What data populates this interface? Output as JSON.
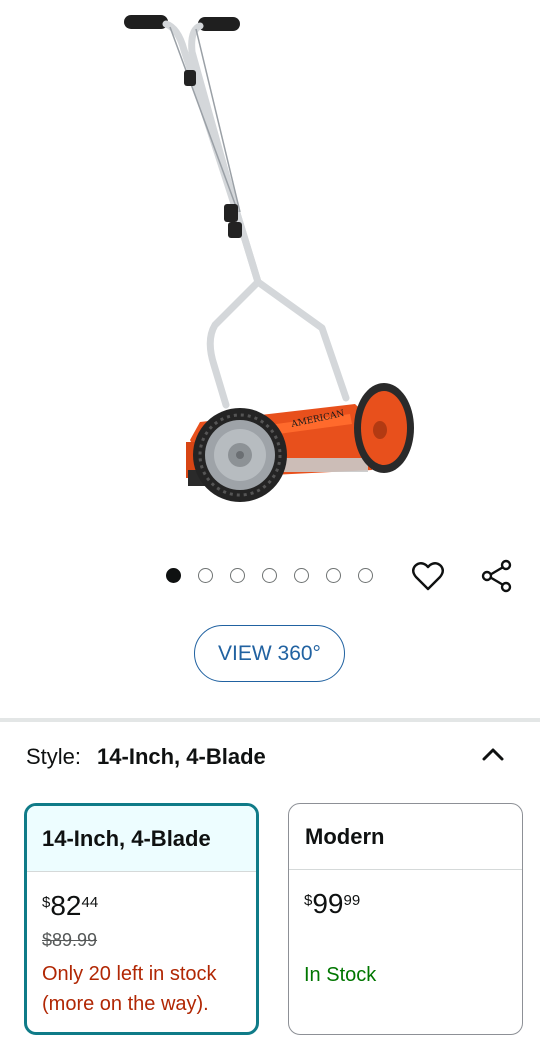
{
  "product_image": {
    "alt_semantic": "reel-lawn-mower",
    "deck_text": "AMERICAN",
    "colors": {
      "body": "#e8501c",
      "handle": "#d9dcdf",
      "tire": "#2a2a2a",
      "hub": "#9ea3a8",
      "grip": "#1f1f1f"
    }
  },
  "carousel": {
    "count": 7,
    "active_index": 0
  },
  "actions": {
    "wishlist_icon": "heart-icon",
    "share_icon": "share-icon"
  },
  "view360": {
    "label": "VIEW 360°"
  },
  "style": {
    "label": "Style:",
    "value": "14-Inch, 4-Blade",
    "toggle_icon": "chevron-up-icon"
  },
  "options": [
    {
      "name": "14-Inch, 4-Blade",
      "selected": true,
      "price": {
        "symbol": "$",
        "whole": "82",
        "fraction": "44"
      },
      "list_price": "$89.99",
      "availability": [
        "Only 20 left in stock",
        "(more on the way)."
      ],
      "availability_color": "#b12704"
    },
    {
      "name": "Modern",
      "selected": false,
      "price": {
        "symbol": "$",
        "whole": "99",
        "fraction": "99"
      },
      "availability": [
        "In Stock"
      ],
      "availability_color": "#007600"
    }
  ],
  "colors": {
    "accent_border": "#0f7b88",
    "link": "#2162a1",
    "selected_bg": "#edfdff"
  }
}
